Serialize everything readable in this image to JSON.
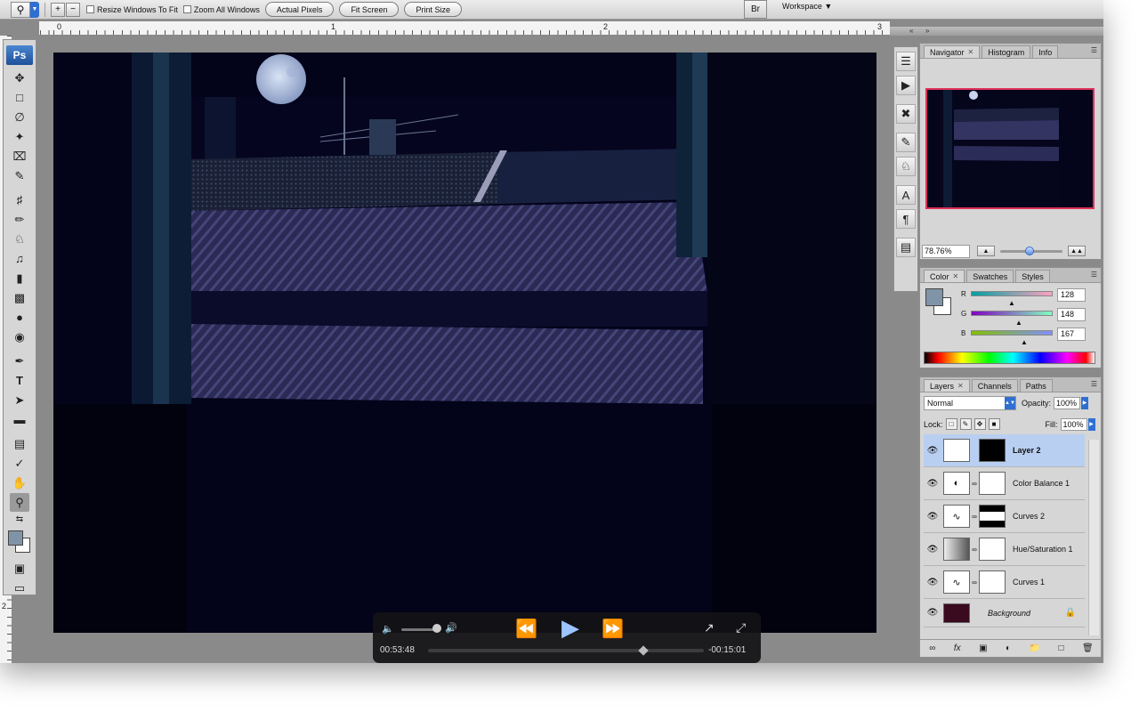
{
  "options_bar": {
    "tool_icon": "zoom-icon",
    "checkboxes": [
      "Resize Windows To Fit",
      "Zoom All Windows"
    ],
    "buttons": [
      "Actual Pixels",
      "Fit Screen",
      "Print Size"
    ],
    "workspace_label": "Workspace"
  },
  "ruler": {
    "top_numbers": [
      "0",
      "1",
      "2",
      "3"
    ],
    "left_number": "2"
  },
  "toolbox": {
    "logo": "Ps"
  },
  "video": {
    "elapsed": "00:53:48",
    "remaining": "-00:15:01",
    "progress": 0.78
  },
  "navigator": {
    "tabs": [
      "Navigator",
      "Histogram",
      "Info"
    ],
    "zoom": "78.76%"
  },
  "color_panel": {
    "tabs": [
      "Color",
      "Swatches",
      "Styles"
    ],
    "channels": [
      {
        "label": "R",
        "value": "128"
      },
      {
        "label": "G",
        "value": "148"
      },
      {
        "label": "B",
        "value": "167"
      }
    ],
    "foreground": "#8094a7"
  },
  "layers_panel": {
    "tabs": [
      "Layers",
      "Channels",
      "Paths"
    ],
    "blend_mode": "Normal",
    "opacity_label": "Opacity:",
    "opacity": "100%",
    "lock_label": "Lock:",
    "fill_label": "Fill:",
    "fill": "100%",
    "layers": [
      {
        "name": "Layer 2",
        "selected": true
      },
      {
        "name": "Color Balance 1",
        "selected": false
      },
      {
        "name": "Curves 2",
        "selected": false
      },
      {
        "name": "Hue/Saturation 1",
        "selected": false
      },
      {
        "name": "Curves 1",
        "selected": false
      },
      {
        "name": "Background",
        "selected": false
      }
    ]
  }
}
